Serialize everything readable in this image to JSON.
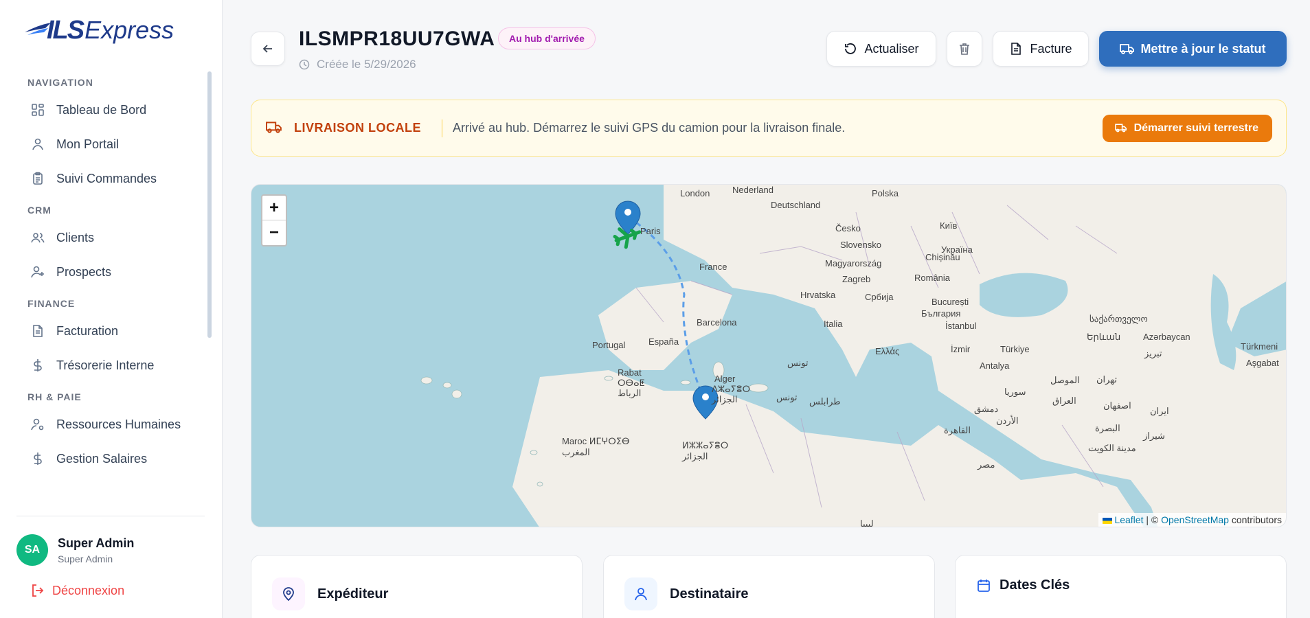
{
  "app": {
    "logo_mark": "ILS",
    "logo_text": "Express"
  },
  "sidebar": {
    "sections": [
      {
        "title": "NAVIGATION",
        "items": [
          "Tableau de Bord",
          "Mon Portail",
          "Suivi Commandes"
        ]
      },
      {
        "title": "CRM",
        "items": [
          "Clients",
          "Prospects"
        ]
      },
      {
        "title": "FINANCE",
        "items": [
          "Facturation",
          "Trésorerie Interne"
        ]
      },
      {
        "title": "RH & PAIE",
        "items": [
          "Ressources Humaines",
          "Gestion Salaires"
        ]
      }
    ],
    "user": {
      "initials": "SA",
      "name": "Super Admin",
      "role": "Super Admin"
    },
    "logout_label": "Déconnexion"
  },
  "header": {
    "order_id": "ILSMPR18UU7GWA",
    "status_badge": "Au hub d'arrivée",
    "created": "Créée le 5/29/2026",
    "refresh_label": "Actualiser",
    "invoice_label": "Facture",
    "update_status_label": "Mettre à jour le statut"
  },
  "banner": {
    "title": "LIVRAISON LOCALE",
    "message": "Arrivé au hub. Démarrez le suivi GPS du camion pour la livraison finale.",
    "button_label": "Démarrer suivi terrestre"
  },
  "map": {
    "zoom_in": "+",
    "zoom_out": "−",
    "attribution_leaflet": "Leaflet",
    "attribution_sep": " | © ",
    "attribution_osm": "OpenStreetMap",
    "attribution_suffix": " contributors",
    "labels": {
      "london": "London",
      "nederland": "Nederland",
      "deutschland": "Deutschland",
      "polska": "Polska",
      "cesko": "Česko",
      "kyiv": "Київ",
      "slovensko": "Slovensko",
      "ukraina": "Україна",
      "paris": "Paris",
      "chisinau": "Chișinău",
      "magyarorszag": "Magyarország",
      "france": "France",
      "zagreb": "Zagreb",
      "romania": "România",
      "hrvatska": "Hrvatska",
      "srbija": "Србија",
      "bucuresti": "București",
      "balgaria": "България",
      "barcelona": "Barcelona",
      "italia": "Italia",
      "istanbul": "İstanbul",
      "sakartvelo": "საქართველო",
      "portugal": "Portugal",
      "espana": "España",
      "hayastan": "Երևան",
      "azarbaycan": "Azərbaycan",
      "ellada": "Ελλάς",
      "izmir": "İzmir",
      "turkiye": "Türkiye",
      "tabriz": "تبریز",
      "turkmen": "Türkmeni",
      "antalya": "Antalya",
      "tunis": "تونس",
      "asgabat": "Aşgabat",
      "rabat": "Rabat",
      "rabat2": "ⵔⴱⴰⵟ",
      "rabat3": "الرباط",
      "alger": "Alger",
      "alger2": "ⴷⵣⴰⵢⴻⵔ",
      "alger3": "الجزائر",
      "tunis2": "تونس",
      "tarabulus": "طرابلس",
      "suriya": "سوريا",
      "tehran": "تهران",
      "mawsil": "الموصل",
      "iraq": "العراق",
      "dimashq": "دمشق",
      "urdun": "الأردن",
      "isfahan": "اصفهان",
      "iran": "ایران",
      "basra": "البصرة",
      "shiraz": "شیراز",
      "kuwait": "مدينة الكويت",
      "qahira": "القاهرة",
      "misr": "مصر",
      "maroc": "Maroc ⵍⵎⵖⵔⵉⴱ",
      "maghrib": "المغرب",
      "dzayer": "ⵍⵣⵣⴰⵢⴻⵔ",
      "jazair": "الجزائر",
      "libya": "ليبيا"
    },
    "colors": {
      "sea": "#aad3df",
      "land": "#f2efe9",
      "route": "#5b9ee8",
      "pin": "#2a81cb",
      "plane": "#16a34a"
    }
  },
  "cards": {
    "sender_title": "Expéditeur",
    "recipient_title": "Destinataire",
    "dates_title": "Dates Clés"
  }
}
